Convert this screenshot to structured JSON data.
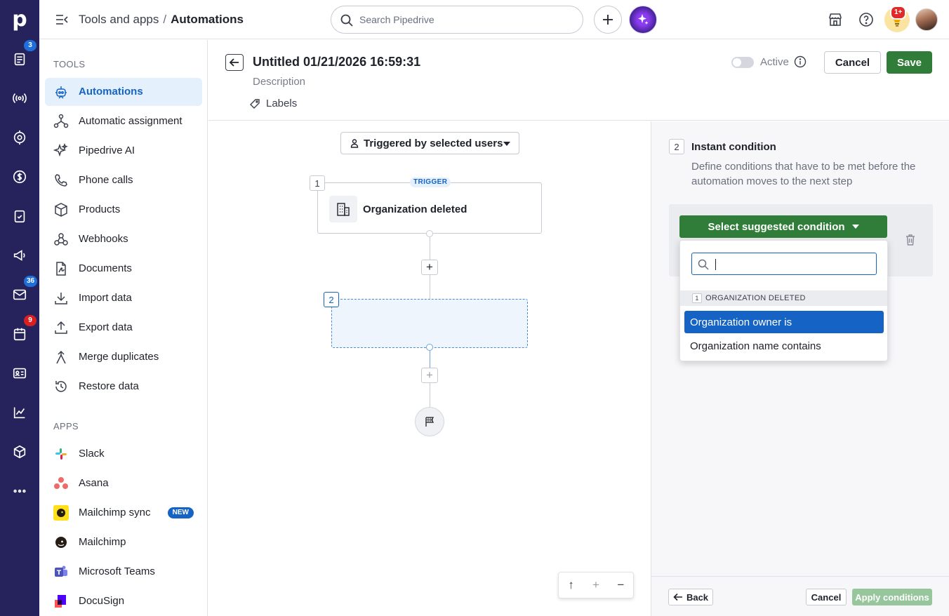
{
  "app": {
    "logo_letter": "p"
  },
  "rail": {
    "badges": {
      "leads": "3",
      "mail": "36",
      "activities": "9"
    }
  },
  "topbar": {
    "breadcrumb_parent": "Tools and apps",
    "breadcrumb_separator": "/",
    "breadcrumb_current": "Automations",
    "search_placeholder": "Search Pipedrive",
    "notifications_badge": "1+"
  },
  "sidebar": {
    "tools_title": "TOOLS",
    "tools": [
      {
        "label": "Automations",
        "icon": "robot-icon",
        "active": true
      },
      {
        "label": "Automatic assignment",
        "icon": "assignment-icon"
      },
      {
        "label": "Pipedrive AI",
        "icon": "sparkle-icon"
      },
      {
        "label": "Phone calls",
        "icon": "phone-icon"
      },
      {
        "label": "Products",
        "icon": "box-icon"
      },
      {
        "label": "Webhooks",
        "icon": "webhook-icon"
      },
      {
        "label": "Documents",
        "icon": "document-icon"
      },
      {
        "label": "Import data",
        "icon": "import-icon"
      },
      {
        "label": "Export data",
        "icon": "export-icon"
      },
      {
        "label": "Merge duplicates",
        "icon": "merge-icon"
      },
      {
        "label": "Restore data",
        "icon": "restore-icon"
      }
    ],
    "apps_title": "APPS",
    "apps": [
      {
        "label": "Slack",
        "icon": "slack-icon"
      },
      {
        "label": "Asana",
        "icon": "asana-icon"
      },
      {
        "label": "Mailchimp sync",
        "icon": "mailchimp-icon",
        "badge": "NEW"
      },
      {
        "label": "Mailchimp",
        "icon": "mailchimp-icon"
      },
      {
        "label": "Microsoft Teams",
        "icon": "teams-icon"
      },
      {
        "label": "DocuSign",
        "icon": "docusign-icon"
      }
    ]
  },
  "editor": {
    "title": "Untitled 01/21/2026 16:59:31",
    "description_placeholder": "Description",
    "labels_label": "Labels",
    "active_label": "Active",
    "cancel_label": "Cancel",
    "save_label": "Save"
  },
  "canvas": {
    "trigger_selector": "Triggered by selected users",
    "step1_number": "1",
    "trigger_tag": "TRIGGER",
    "trigger_title": "Organization deleted",
    "step2_number": "2"
  },
  "panel": {
    "step_number": "2",
    "title": "Instant condition",
    "description": "Define conditions that have to be met before the automation moves to the next step",
    "suggest_button": "Select suggested condition",
    "dropdown": {
      "search_value": "",
      "group_number": "1",
      "group_label": "ORGANIZATION DELETED",
      "options": [
        {
          "label": "Organization owner is",
          "selected": true
        },
        {
          "label": "Organization name contains",
          "selected": false
        }
      ]
    },
    "back_label": "Back",
    "cancel_label": "Cancel",
    "apply_label": "Apply conditions"
  },
  "colors": {
    "rail_bg": "#26235c",
    "accent_blue": "#1563c4",
    "primary_green": "#2f7d38",
    "disabled_green": "#97c69c"
  }
}
